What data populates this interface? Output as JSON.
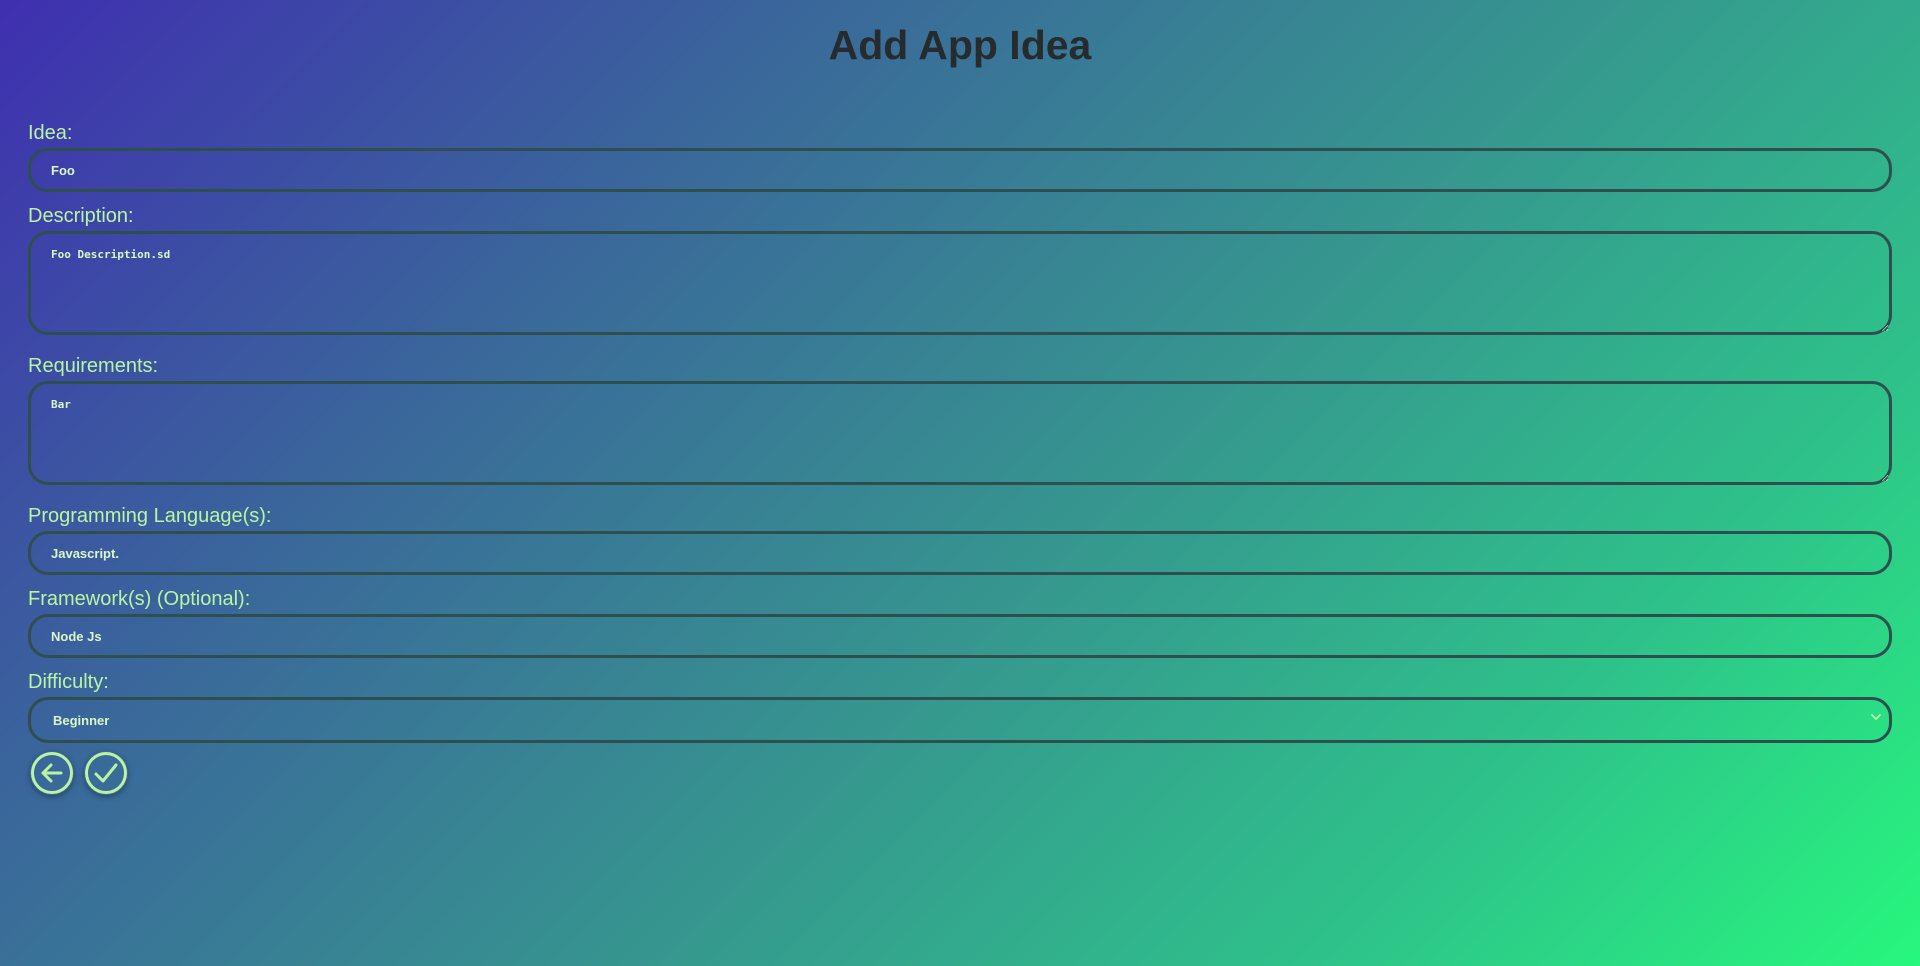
{
  "page": {
    "title": "Add App Idea"
  },
  "form": {
    "idea": {
      "label": "Idea:",
      "value": "Foo"
    },
    "description": {
      "label": "Description:",
      "value": "Foo Description.sd"
    },
    "requirements": {
      "label": "Requirements:",
      "value": "Bar"
    },
    "languages": {
      "label": "Programming Language(s):",
      "value": "Javascript."
    },
    "frameworks": {
      "label": "Framework(s) (Optional):",
      "value": "Node Js"
    },
    "difficulty": {
      "label": "Difficulty:",
      "selected": "Beginner"
    }
  },
  "actions": {
    "back_icon": "arrow-left-circle-icon",
    "submit_icon": "check-circle-icon"
  },
  "colors": {
    "accent": "#b9f5a0",
    "border": "#2f4f4f",
    "title": "#262b2e",
    "gradient_start": "#3f2fb0",
    "gradient_end": "#27f77d"
  }
}
